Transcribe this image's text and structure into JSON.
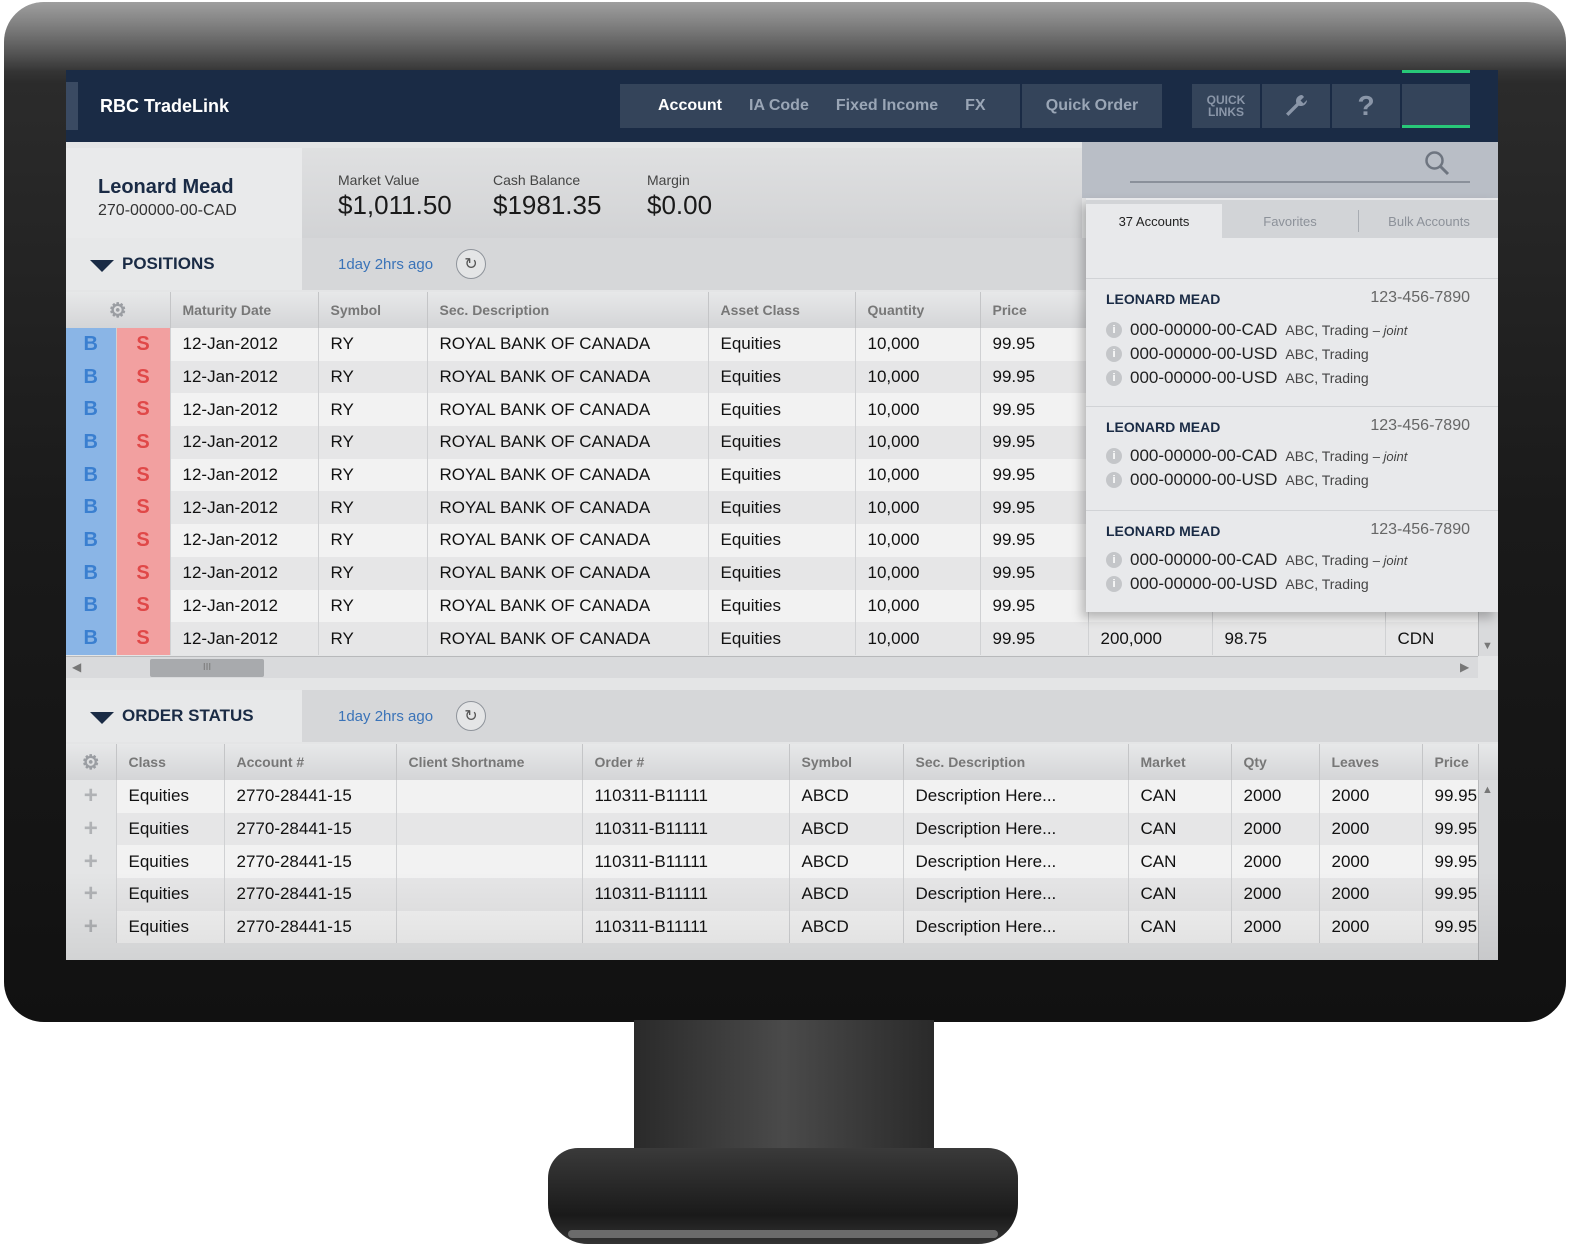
{
  "app": {
    "title": "RBC TradeLink"
  },
  "nav": {
    "items": [
      "Account",
      "IA Code",
      "Fixed Income",
      "FX"
    ],
    "active": "Account",
    "quick_order": "Quick Order",
    "quick_links_line1": "QUICK",
    "quick_links_line2": "LINKS",
    "help": "?"
  },
  "account": {
    "name": "Leonard Mead",
    "number": "270-00000-00-CAD",
    "metrics": [
      {
        "label": "Market Value",
        "value": "$1,011.50"
      },
      {
        "label": "Cash Balance",
        "value": "$1981.35"
      },
      {
        "label": "Margin",
        "value": "$0.00"
      }
    ]
  },
  "positions": {
    "title": "POSITIONS",
    "updated": "1day 2hrs ago",
    "columns": [
      "Maturity Date",
      "Symbol",
      "Sec. Description",
      "Asset Class",
      "Quantity",
      "Price"
    ],
    "buy_label": "B",
    "sell_label": "S",
    "rows": [
      [
        "12-Jan-2012",
        "RY",
        "ROYAL BANK OF CANADA",
        "Equities",
        "10,000",
        "99.95"
      ],
      [
        "12-Jan-2012",
        "RY",
        "ROYAL BANK OF CANADA",
        "Equities",
        "10,000",
        "99.95"
      ],
      [
        "12-Jan-2012",
        "RY",
        "ROYAL BANK OF CANADA",
        "Equities",
        "10,000",
        "99.95"
      ],
      [
        "12-Jan-2012",
        "RY",
        "ROYAL BANK OF CANADA",
        "Equities",
        "10,000",
        "99.95"
      ],
      [
        "12-Jan-2012",
        "RY",
        "ROYAL BANK OF CANADA",
        "Equities",
        "10,000",
        "99.95"
      ],
      [
        "12-Jan-2012",
        "RY",
        "ROYAL BANK OF CANADA",
        "Equities",
        "10,000",
        "99.95"
      ],
      [
        "12-Jan-2012",
        "RY",
        "ROYAL BANK OF CANADA",
        "Equities",
        "10,000",
        "99.95"
      ],
      [
        "12-Jan-2012",
        "RY",
        "ROYAL BANK OF CANADA",
        "Equities",
        "10,000",
        "99.95"
      ],
      [
        "12-Jan-2012",
        "RY",
        "ROYAL BANK OF CANADA",
        "Equities",
        "10,000",
        "99.95"
      ],
      [
        "12-Jan-2012",
        "RY",
        "ROYAL BANK OF CANADA",
        "Equities",
        "10,000",
        "99.95"
      ]
    ],
    "last_row_extra": [
      "200,000",
      "98.75",
      "CDN"
    ]
  },
  "accounts_panel": {
    "tabs": [
      "37 Accounts",
      "Favorites",
      "Bulk Accounts"
    ],
    "active_tab": "37 Accounts",
    "groups": [
      {
        "name": "LEONARD MEAD",
        "phone": "123-456-7890",
        "accounts": [
          {
            "number": "000-00000-00-CAD",
            "desc": "ABC, Trading",
            "joint": "– joint"
          },
          {
            "number": "000-00000-00-USD",
            "desc": "ABC, Trading",
            "joint": ""
          },
          {
            "number": "000-00000-00-USD",
            "desc": "ABC, Trading",
            "joint": ""
          }
        ]
      },
      {
        "name": "LEONARD MEAD",
        "phone": "123-456-7890",
        "accounts": [
          {
            "number": "000-00000-00-CAD",
            "desc": "ABC, Trading",
            "joint": "– joint"
          },
          {
            "number": "000-00000-00-USD",
            "desc": "ABC, Trading",
            "joint": ""
          }
        ]
      },
      {
        "name": "LEONARD MEAD",
        "phone": "123-456-7890",
        "accounts": [
          {
            "number": "000-00000-00-CAD",
            "desc": "ABC, Trading",
            "joint": "– joint"
          },
          {
            "number": "000-00000-00-USD",
            "desc": "ABC, Trading",
            "joint": ""
          }
        ]
      }
    ]
  },
  "order_status": {
    "title": "ORDER STATUS",
    "updated": "1day 2hrs ago",
    "columns": [
      "Class",
      "Account #",
      "Client Shortname",
      "Order #",
      "Symbol",
      "Sec. Description",
      "Market",
      "Qty",
      "Leaves",
      "Price"
    ],
    "rows": [
      [
        "Equities",
        "2770-28441-15",
        "",
        "110311-B11111",
        "ABCD",
        "Description Here...",
        "CAN",
        "2000",
        "2000",
        "99.95"
      ],
      [
        "Equities",
        "2770-28441-15",
        "",
        "110311-B11111",
        "ABCD",
        "Description Here...",
        "CAN",
        "2000",
        "2000",
        "99.95"
      ],
      [
        "Equities",
        "2770-28441-15",
        "",
        "110311-B11111",
        "ABCD",
        "Description Here...",
        "CAN",
        "2000",
        "2000",
        "99.95"
      ],
      [
        "Equities",
        "2770-28441-15",
        "",
        "110311-B11111",
        "ABCD",
        "Description Here...",
        "CAN",
        "2000",
        "2000",
        "99.95"
      ],
      [
        "Equities",
        "2770-28441-15",
        "",
        "110311-B11111",
        "ABCD",
        "Description Here...",
        "CAN",
        "2000",
        "2000",
        "99.95"
      ]
    ]
  }
}
